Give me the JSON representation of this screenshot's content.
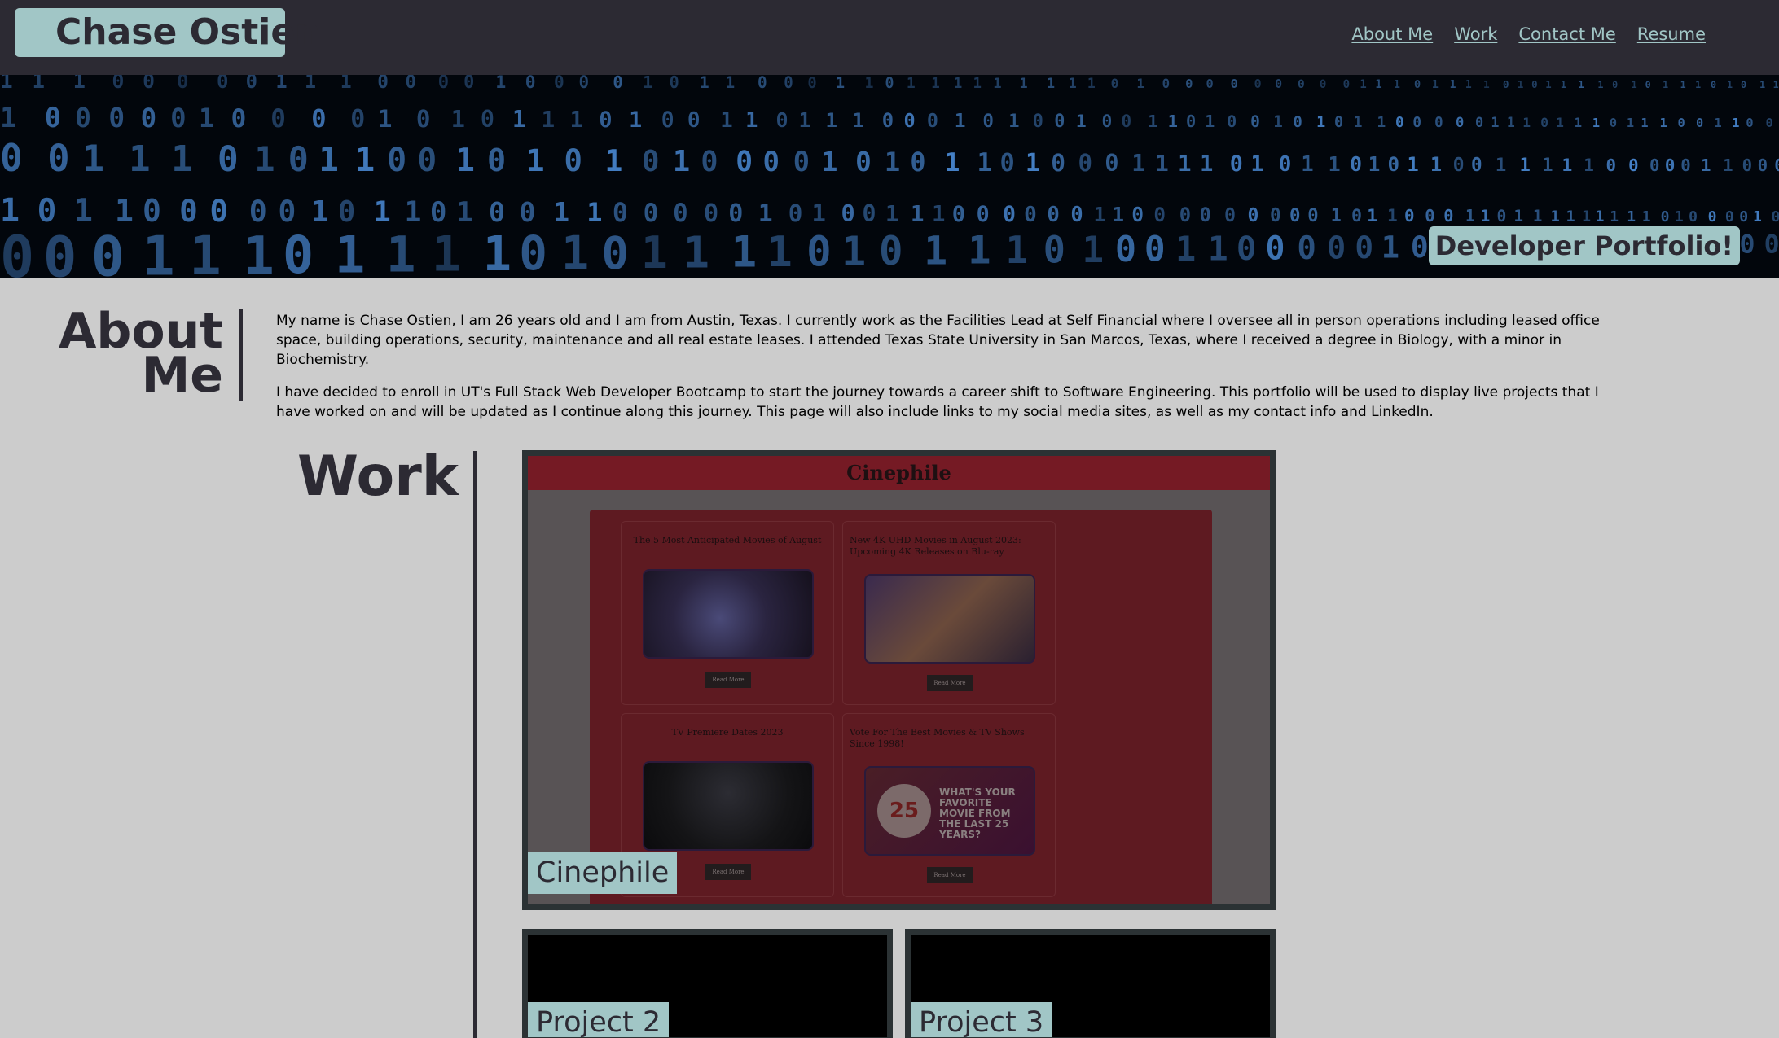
{
  "header": {
    "logo": "Chase Ostien",
    "nav": [
      "About Me",
      "Work",
      "Contact Me",
      "Resume"
    ]
  },
  "hero": {
    "badge": "Developer Portfolio!",
    "background_icon": "binary-code-image"
  },
  "about": {
    "title_line1": "About",
    "title_line2": "Me",
    "paragraph1": "My name is Chase Ostien, I am 26 years old and I am from Austin, Texas. I currently work as the Facilities Lead at Self Financial where I oversee all in person operations including leased office space, building operations, security, maintenance and all real estate leases. I attended Texas State University in San Marcos, Texas, where I received a degree in Biology, with a minor in Biochemistry.",
    "paragraph2": "I have decided to enroll in UT's Full Stack Web Developer Bootcamp to start the journey towards a career shift to Software Engineering. This portfolio will be used to display live projects that I have worked on and will be updated as I continue along this journey. This page will also include links to my social media sites, as well as my contact info and LinkedIn."
  },
  "work": {
    "title": "Work",
    "projects": [
      {
        "label": "Cinephile",
        "preview": {
          "site_title": "Cinephile",
          "cards": [
            {
              "title": "The 5 Most Anticipated Movies of August",
              "button": "Read More"
            },
            {
              "title": "New 4K UHD Movies in August 2023: Upcoming 4K Releases on Blu-ray",
              "button": "Read More"
            },
            {
              "title": "TV Premiere Dates 2023",
              "button": "Read More"
            },
            {
              "title": "Vote For The Best Movies & TV Shows Since 1998!",
              "button": "Read More",
              "image_badge": "25",
              "image_text": "WHAT'S YOUR FAVORITE MOVIE FROM THE LAST 25 YEARS?"
            }
          ]
        }
      },
      {
        "label": "Project 2"
      },
      {
        "label": "Project 3"
      }
    ]
  }
}
